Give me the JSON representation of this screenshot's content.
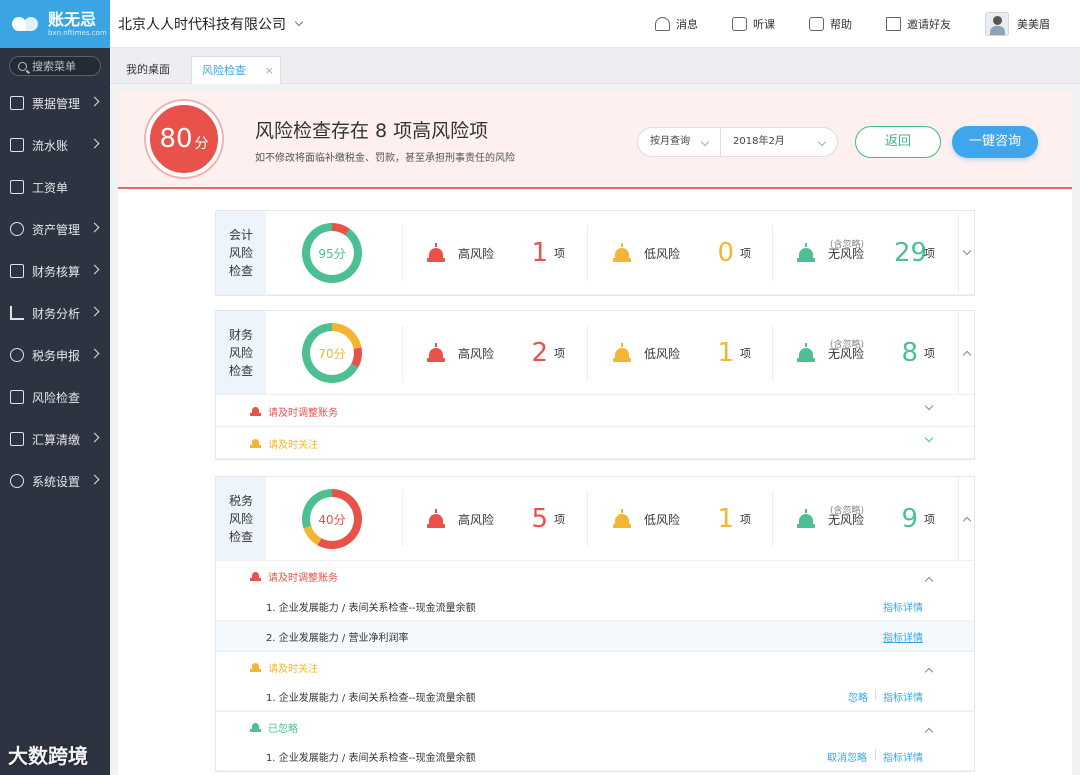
{
  "app": {
    "logo_name": "账无忌",
    "logo_sub": "bxn.nftimes.com"
  },
  "sidebar": {
    "search_placeholder": "搜索菜单",
    "items": [
      {
        "label": "票据管理",
        "icon": "invoice-icon",
        "arrow": true
      },
      {
        "label": "流水账",
        "icon": "ledger-icon",
        "arrow": true
      },
      {
        "label": "工资单",
        "icon": "payroll-icon",
        "arrow": false
      },
      {
        "label": "资产管理",
        "icon": "house-icon",
        "arrow": true
      },
      {
        "label": "财务核算",
        "icon": "calculator-icon",
        "arrow": true
      },
      {
        "label": "财务分析",
        "icon": "bar-chart-icon",
        "arrow": true
      },
      {
        "label": "税务申报",
        "icon": "tax-icon",
        "arrow": true
      },
      {
        "label": "风险检查",
        "icon": "siren-icon",
        "arrow": false
      },
      {
        "label": "汇算清缴",
        "icon": "document-icon",
        "arrow": true
      },
      {
        "label": "系统设置",
        "icon": "gear-icon",
        "arrow": true
      }
    ]
  },
  "topbar": {
    "company": "北京人人时代科技有限公司",
    "actions": [
      {
        "label": "消息",
        "icon": "bell-icon"
      },
      {
        "label": "听课",
        "icon": "video-icon"
      },
      {
        "label": "帮助",
        "icon": "help-doc-icon"
      },
      {
        "label": "邀请好友",
        "icon": "gift-icon"
      }
    ],
    "user": "美美眉"
  },
  "tabs": [
    {
      "label": "我的桌面"
    },
    {
      "label": "风险检查",
      "close": "×",
      "active": true
    }
  ],
  "hero": {
    "score": "80",
    "score_unit": "分",
    "title": "风险检查存在 8 项高风险项",
    "subtitle": "如不修改将面临补缴税金、罚款，甚至承担刑事责任的风险",
    "query_mode": "按月查询",
    "month": "2018年2月",
    "back_label": "返回",
    "consult_label": "一键咨询"
  },
  "colors": {
    "red": "#e9524a",
    "yellow": "#f2b634",
    "green": "#4cbf93",
    "blue": "#3ba5e4"
  },
  "labels": {
    "high": "高风险",
    "low": "低风险",
    "none": "无风险",
    "unit": "项",
    "ignored_note": "(含忽略)",
    "detail": "指标详情",
    "ignore": "忽略",
    "unignore": "取消忽略"
  },
  "checks": [
    {
      "title": "会计\n风险\n检查",
      "score": "95分",
      "high": "1",
      "low": "0",
      "none": "29",
      "expanded": false
    },
    {
      "title": "财务\n风险\n检查",
      "score": "70分",
      "high": "2",
      "low": "1",
      "none": "8",
      "expanded": true,
      "groups": [
        {
          "label": "请及时调整账务"
        },
        {
          "label": "请及时关注"
        }
      ]
    },
    {
      "title": "税务\n风险\n检查",
      "score": "40分",
      "high": "5",
      "low": "1",
      "none": "9",
      "expanded": true,
      "groups": [
        {
          "label": "请及时调整账务",
          "items": [
            "1.  企业发展能力 / 表间关系检查--现金流量余额",
            "2. 企业发展能力 / 营业净利润率"
          ]
        },
        {
          "label": "请及时关注",
          "items": [
            "1.  企业发展能力 / 表间关系检查--现金流量余额"
          ]
        },
        {
          "label": "已忽略",
          "items": [
            "1.  企业发展能力 / 表间关系检查--现金流量余额"
          ]
        }
      ]
    }
  ],
  "watermark": "大数跨境"
}
